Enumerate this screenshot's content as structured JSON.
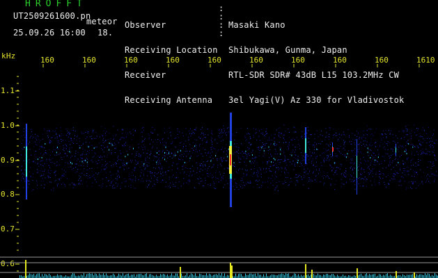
{
  "header": {
    "title": "HROFFT",
    "filename": "UT2509261600.pn",
    "meteor_label": "meteor",
    "datetime": "25.09.26 16:00",
    "count": "18.",
    "fields": [
      {
        "label": "Observer",
        "value": "Masaki Kano"
      },
      {
        "label": "Receiving Location",
        "value": "Shibukawa, Gunma, Japan"
      },
      {
        "label": "Receiver",
        "value": "RTL-SDR SDR# 43dB L15 103.2MHz CW"
      },
      {
        "label": "Receiving Antenna",
        "value": "3el Yagi(V) Az 330 for Vladivostok"
      }
    ]
  },
  "axis": {
    "unit": "kHz",
    "y_ticks": [
      "1.1",
      "1.0",
      "0.9",
      "0.8",
      "0.7",
      "0.6"
    ],
    "x_ticks": [
      "160",
      "160",
      "160",
      "160",
      "160",
      "160",
      "160",
      "160",
      "160",
      "1610"
    ]
  },
  "colors": {
    "background": "#000000",
    "title": "#2bd42b",
    "text": "#f0f0f0",
    "axis": "#e6e62e",
    "noise": "#1a1aa8",
    "meteor": "#ff3030"
  }
}
